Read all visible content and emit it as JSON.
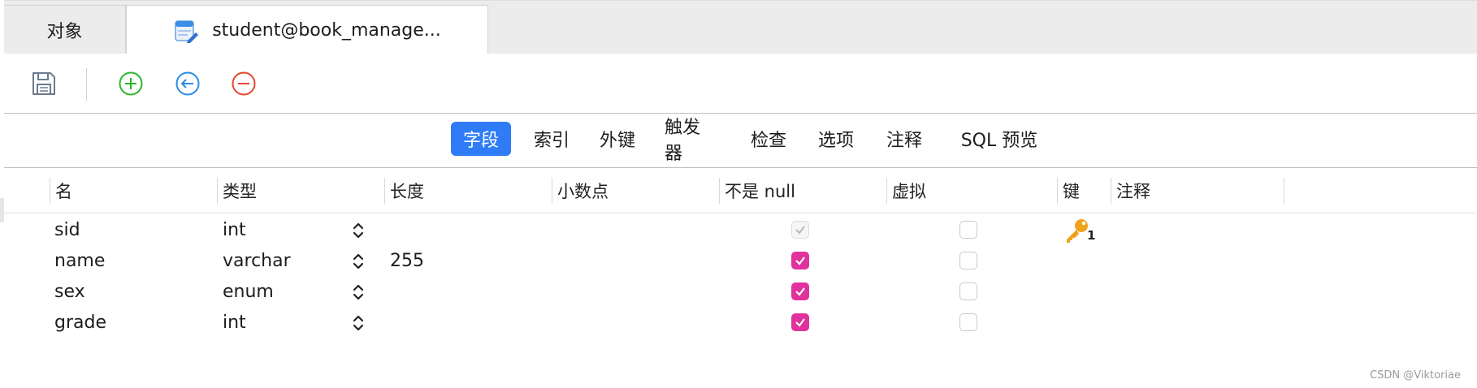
{
  "tabs": [
    {
      "label": "对象"
    },
    {
      "label": "student@book_manage..."
    }
  ],
  "toolbar": {
    "save_icon": "save-icon",
    "add_icon": "add-field-icon",
    "insert_icon": "insert-field-icon",
    "delete_icon": "delete-field-icon"
  },
  "subtabs": [
    "字段",
    "索引",
    "外键",
    "触发器",
    "检查",
    "选项",
    "注释",
    "SQL 预览"
  ],
  "columns": [
    "名",
    "类型",
    "长度",
    "小数点",
    "不是 null",
    "虚拟",
    "键",
    "注释"
  ],
  "rows": [
    {
      "name": "sid",
      "type": "int",
      "length": "",
      "not_null": "checked-disabled",
      "virtual": false,
      "key": "1"
    },
    {
      "name": "name",
      "type": "varchar",
      "length": "255",
      "not_null": "checked",
      "virtual": false,
      "key": ""
    },
    {
      "name": "sex",
      "type": "enum",
      "length": "",
      "not_null": "checked",
      "virtual": false,
      "key": ""
    },
    {
      "name": "grade",
      "type": "int",
      "length": "",
      "not_null": "checked",
      "virtual": false,
      "key": ""
    }
  ],
  "colors": {
    "accent": "#2f7cf6",
    "checkbox": "#e1329c",
    "add": "#2bb52b",
    "insert": "#2a8be5",
    "delete": "#e8442e",
    "key": "#f0a21a"
  },
  "watermark": "CSDN @Viktoriae"
}
